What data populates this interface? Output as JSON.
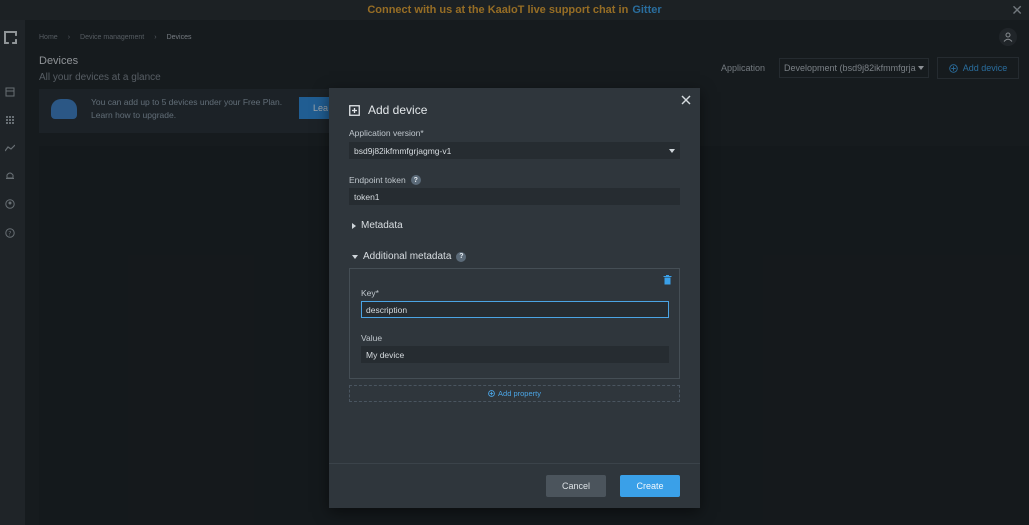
{
  "banner": {
    "text": "Connect with us at the KaaIoT live support chat in",
    "link": "Gitter"
  },
  "breadcrumb": [
    "Home",
    "Device management",
    "Devices"
  ],
  "page": {
    "title": "Devices",
    "subtitle": "All your devices at a glance"
  },
  "application": {
    "label": "Application",
    "selected": "Development (bsd9j82ikfmmfgrja",
    "add_device_label": "Add device"
  },
  "plan": {
    "text_line1": "You can add up to 5 devices under your Free Plan.",
    "text_line2": "Learn how to upgrade.",
    "button": "Lea"
  },
  "modal": {
    "title": "Add device",
    "app_version_label": "Application version*",
    "app_version_value": "bsd9j82ikfmmfgrjagmg-v1",
    "endpoint_token_label": "Endpoint token",
    "endpoint_token_value": "token1",
    "metadata_label": "Metadata",
    "additional_metadata_label": "Additional metadata",
    "key_label": "Key*",
    "key_value": "description",
    "value_label": "Value",
    "value_value": "My device",
    "add_property_label": "Add property",
    "cancel_label": "Cancel",
    "create_label": "Create"
  },
  "colors": {
    "accent": "#3aa0e8",
    "banner_text": "#e0a030"
  }
}
